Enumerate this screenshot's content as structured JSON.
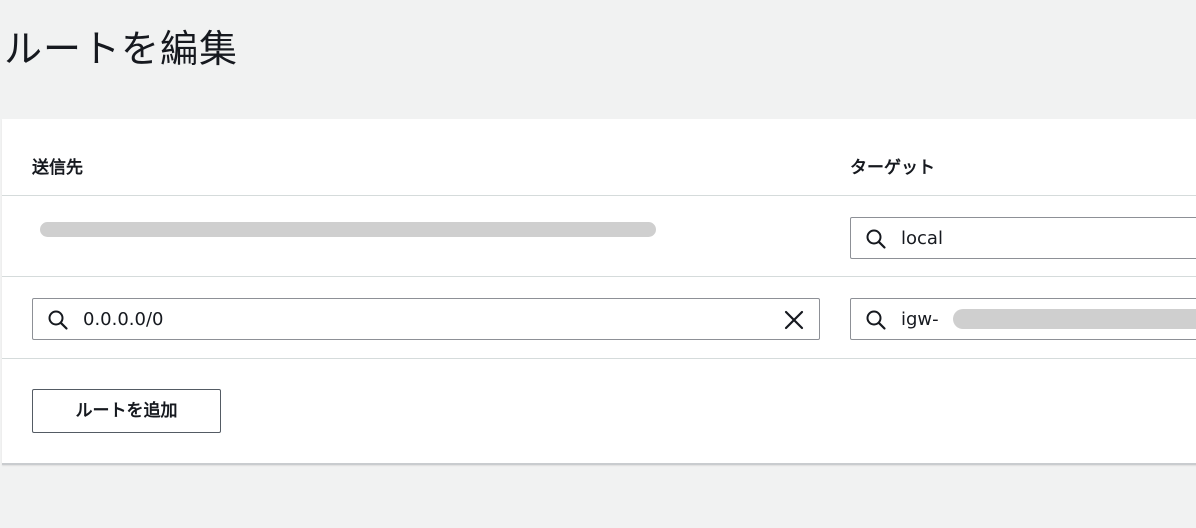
{
  "page": {
    "title": "ルートを編集"
  },
  "table": {
    "headers": {
      "destination": "送信先",
      "target": "ターゲット"
    },
    "rows": [
      {
        "destination": "",
        "destination_redacted": true,
        "target": "local"
      },
      {
        "destination": "0.0.0.0/0",
        "target": "igw-",
        "target_redacted": true
      }
    ]
  },
  "actions": {
    "add_route_label": "ルートを追加"
  },
  "icons": {
    "search": "search-icon",
    "clear": "close-icon"
  },
  "colors": {
    "page_background": "#f1f2f2",
    "panel_background": "#ffffff",
    "text": "#16191f",
    "field_border": "#8d9096",
    "redaction": "#cfcfcf"
  }
}
